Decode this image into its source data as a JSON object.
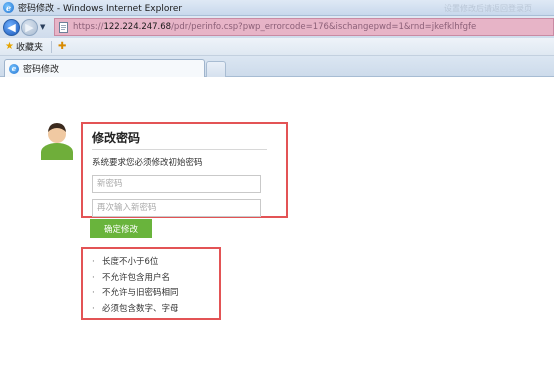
{
  "window": {
    "title": "密码修改 - Windows Internet Explorer",
    "faint_text": "设置修改后请返回登录页"
  },
  "address": {
    "url_prefix": "https://",
    "url_host": "122.224.247.68",
    "url_rest": "/pdr/perinfo.csp?pwp_errorcode=176&ischangepwd=1&rnd=jkefklhfgfe"
  },
  "favorites": {
    "label": "收藏夹"
  },
  "tabs": [
    {
      "label": "密码修改"
    }
  ],
  "form": {
    "title": "修改密码",
    "description": "系统要求您必须修改初始密码",
    "new_password_placeholder": "新密码",
    "repeat_password_placeholder": "再次输入新密码",
    "confirm_label": "确定修改"
  },
  "rules": [
    "长度不小于6位",
    "不允许包含用户名",
    "不允许与旧密码相同",
    "必须包含数字、字母"
  ],
  "colors": {
    "highlight_border": "#e35355",
    "confirm_button": "#69b43c",
    "url_highlight": "#e7b4c7"
  }
}
